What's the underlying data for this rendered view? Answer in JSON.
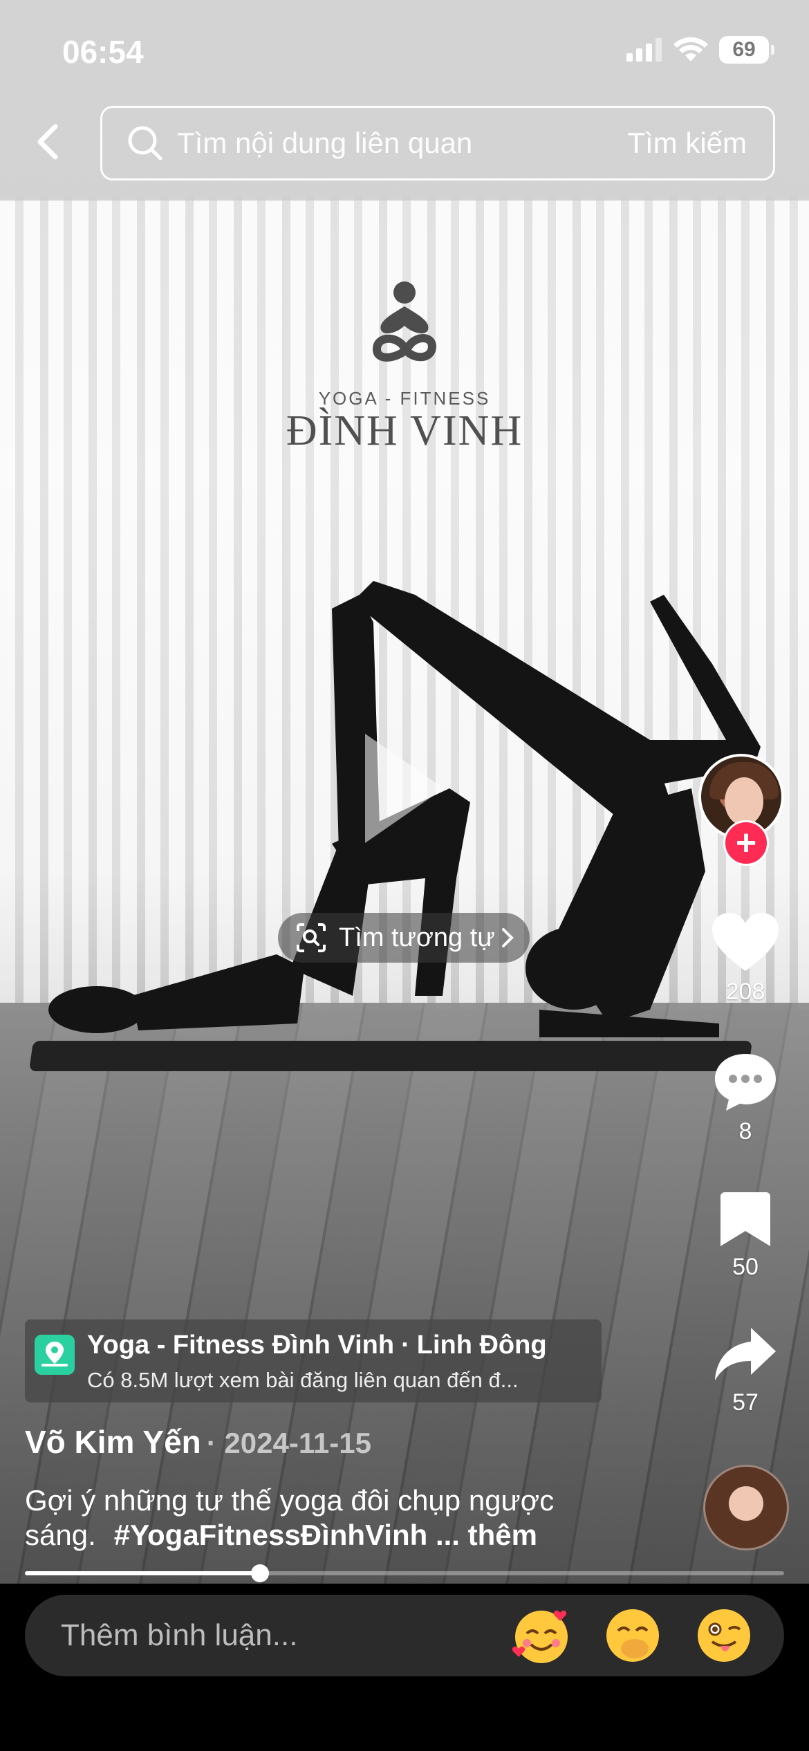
{
  "status_bar": {
    "time": "06:54",
    "battery": "69"
  },
  "search": {
    "placeholder": "Tìm nội dung liên quan",
    "button_label": "Tìm kiếm"
  },
  "video": {
    "logo_sub": "YOGA - FITNESS",
    "logo_main": "ĐÌNH VINH",
    "similar_label": "Tìm tương tự"
  },
  "actions": {
    "likes": "208",
    "comments": "8",
    "saves": "50",
    "shares": "57"
  },
  "location": {
    "name": "Yoga - Fitness Đình Vinh",
    "separator": "·",
    "area": "Linh Đông",
    "subtitle": "Có 8.5M lượt xem bài đăng liên quan đến đ..."
  },
  "post": {
    "author": "Võ Kim Yến",
    "date": "· 2024-11-15",
    "caption": "Gợi ý những tư thế yoga đôi chụp ngược sáng.",
    "hashtag": "#YogaFitnessĐìnhVinh",
    "more": "... thêm"
  },
  "playback": {
    "progress": 0.31
  },
  "comment_bar": {
    "placeholder": "Thêm bình luận..."
  },
  "emojis": [
    "smiling-face-with-hearts",
    "face-with-hand-over-mouth",
    "winking-face-with-tongue"
  ]
}
